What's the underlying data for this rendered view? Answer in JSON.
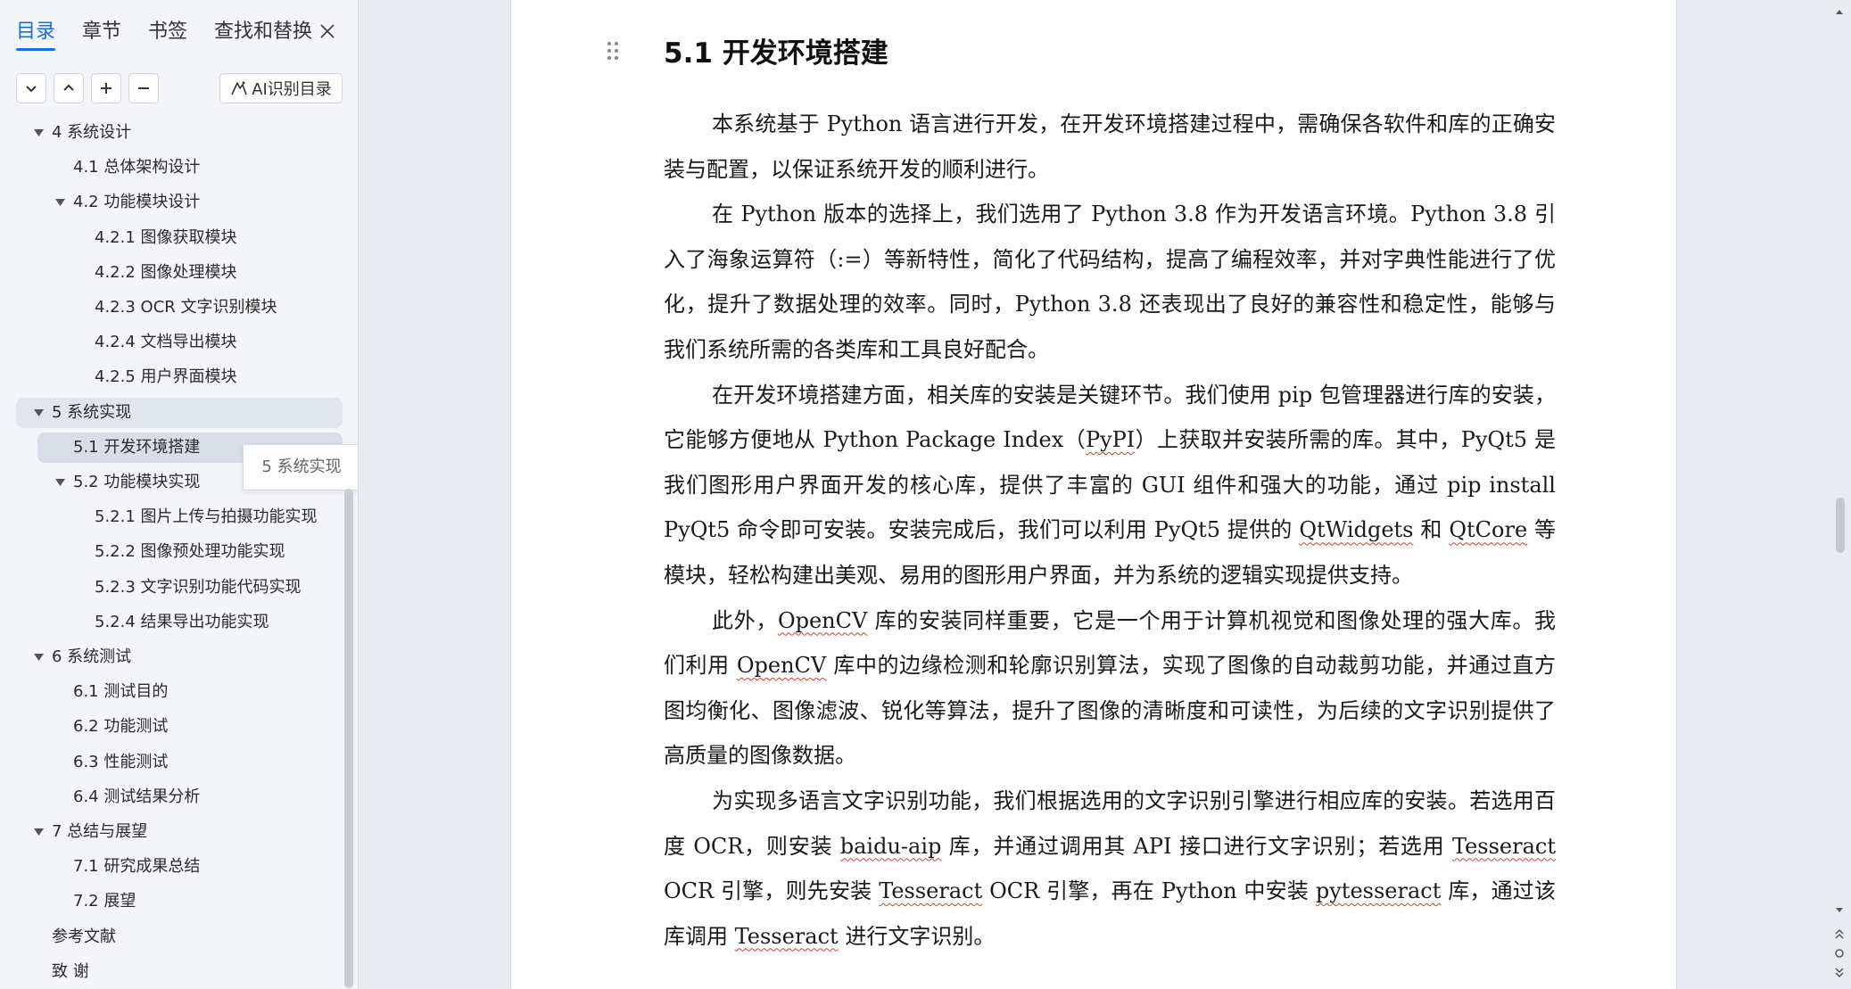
{
  "nav": {
    "tabs": [
      {
        "label": "目录",
        "active": true
      },
      {
        "label": "章节",
        "active": false
      },
      {
        "label": "书签",
        "active": false
      },
      {
        "label": "查找和替换",
        "active": false
      }
    ],
    "ai_button_label": "AI识别目录",
    "tooltip": "5 系统实现",
    "toc": [
      {
        "label": "4  系统设计",
        "level": 0,
        "arrow": true
      },
      {
        "label": "4.1  总体架构设计",
        "level": 1,
        "arrow": false
      },
      {
        "label": "4.2  功能模块设计",
        "level": 1,
        "arrow": true
      },
      {
        "label": "4.2.1  图像获取模块",
        "level": 2,
        "arrow": false
      },
      {
        "label": "4.2.2  图像处理模块",
        "level": 2,
        "arrow": false
      },
      {
        "label": "4.2.3 OCR 文字识别模块",
        "level": 2,
        "arrow": false
      },
      {
        "label": "4.2.4  文档导出模块",
        "level": 2,
        "arrow": false
      },
      {
        "label": "4.2.5  用户界面模块",
        "level": 2,
        "arrow": false
      },
      {
        "label": "5  系统实现",
        "level": 0,
        "arrow": true,
        "highlight": "parent"
      },
      {
        "label": "5.1  开发环境搭建",
        "level": 1,
        "arrow": false,
        "highlight": "current"
      },
      {
        "label": "5.2  功能模块实现",
        "level": 1,
        "arrow": true
      },
      {
        "label": "5.2.1  图片上传与拍摄功能实现",
        "level": 2,
        "arrow": false
      },
      {
        "label": "5.2.2  图像预处理功能实现",
        "level": 2,
        "arrow": false
      },
      {
        "label": "5.2.3  文字识别功能代码实现",
        "level": 2,
        "arrow": false
      },
      {
        "label": "5.2.4  结果导出功能实现",
        "level": 2,
        "arrow": false
      },
      {
        "label": "6  系统测试",
        "level": 0,
        "arrow": true
      },
      {
        "label": "6.1  测试目的",
        "level": 1,
        "arrow": false
      },
      {
        "label": "6.2  功能测试",
        "level": 1,
        "arrow": false
      },
      {
        "label": "6.3  性能测试",
        "level": 1,
        "arrow": false
      },
      {
        "label": "6.4  测试结果分析",
        "level": 1,
        "arrow": false
      },
      {
        "label": "7  总结与展望",
        "level": 0,
        "arrow": true
      },
      {
        "label": "7.1  研究成果总结",
        "level": 1,
        "arrow": false
      },
      {
        "label": "7.2  展望",
        "level": 1,
        "arrow": false
      },
      {
        "label": "参考文献",
        "level": 0,
        "arrow": false
      },
      {
        "label": "致    谢",
        "level": 0,
        "arrow": false
      }
    ]
  },
  "document": {
    "heading": "5.1  开发环境搭建",
    "paragraphs": [
      [
        {
          "t": "本系统基于 Python 语言进行开发，在开发环境搭建过程中，需确保各软件和库的正确安装与配置，以保证系统开发的顺利进行。"
        }
      ],
      [
        {
          "t": "在 Python 版本的选择上，我们选用了 Python 3.8 作为开发语言环境。Python 3.8 引入了海象运算符（:=）等新特性，简化了代码结构，提高了编程效率，并对字典性能进行了优化，提升了数据处理的效率。同时，Python 3.8 还表现出了良好的兼容性和稳定性，能够与我们系统所需的各类库和工具良好配合。"
        }
      ],
      [
        {
          "t": "在开发环境搭建方面，相关库的安装是关键环节。我们使用 pip 包管理器进行库的安装，它能够方便地从 Python Package Index（"
        },
        {
          "t": "PyPI",
          "sq": true
        },
        {
          "t": "）上获取并安装所需的库。其中，PyQt5 是我们图形用户界面开发的核心库，提供了丰富的 GUI 组件和强大的功能，通过 pip install PyQt5 命令即可安装。安装完成后，我们可以利用 PyQt5 提供的 "
        },
        {
          "t": "QtWidgets",
          "sq": true
        },
        {
          "t": " 和 "
        },
        {
          "t": "QtCore",
          "sq": true
        },
        {
          "t": " 等模块，轻松构建出美观、易用的图形用户界面，并为系统的逻辑实现提供支持。"
        }
      ],
      [
        {
          "t": "此外，"
        },
        {
          "t": "OpenCV",
          "sq": true
        },
        {
          "t": " 库的安装同样重要，它是一个用于计算机视觉和图像处理的强大库。我们利用 "
        },
        {
          "t": "OpenCV",
          "sq": true
        },
        {
          "t": " 库中的边缘检测和轮廓识别算法，实现了图像的自动裁剪功能，并通过直方图均衡化、图像滤波、锐化等算法，提升了图像的清晰度和可读性，为后续的文字识别提供了高质量的图像数据。"
        }
      ],
      [
        {
          "t": "为实现多语言文字识别功能，我们根据选用的文字识别引擎进行相应库的安装。若选用百度 OCR，则安装 "
        },
        {
          "t": "baidu-aip",
          "sq": true
        },
        {
          "t": " 库，并通过调用其 API 接口进行文字识别；若选用 "
        },
        {
          "t": "Tesseract",
          "sq": true
        },
        {
          "t": " OCR 引擎，则先安装 "
        },
        {
          "t": "Tesseract",
          "sq": true
        },
        {
          "t": " OCR 引擎，再在 Python 中安装 "
        },
        {
          "t": "pytesseract",
          "sq": true
        },
        {
          "t": " 库，通过该库调用 "
        },
        {
          "t": "Tesseract",
          "sq": true
        },
        {
          "t": " 进行文字识别。"
        }
      ]
    ]
  }
}
